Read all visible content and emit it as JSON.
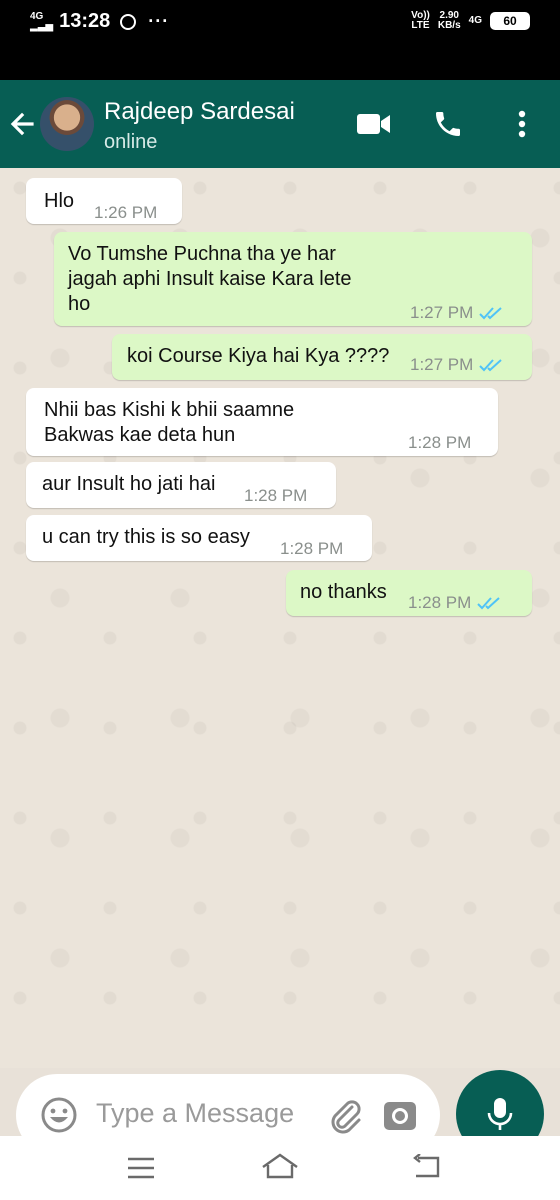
{
  "status_bar": {
    "network": "4G",
    "time": "13:28",
    "dots": "···",
    "volte_top": "Vo))",
    "volte_bottom": "LTE",
    "speed_top": "2.90",
    "speed_bottom": "KB/s",
    "network_right": "4G",
    "battery": "60"
  },
  "header": {
    "contact_name": "Rajdeep Sardesai",
    "contact_status": "online",
    "accent_color": "#075e54"
  },
  "messages": [
    {
      "direction": "in",
      "text": "Hlo",
      "time": "1:26 PM"
    },
    {
      "direction": "out",
      "text_lines": [
        "Vo Tumshe Puchna tha ye har",
        "jagah aphi Insult kaise Kara lete",
        "ho"
      ],
      "time": "1:27 PM",
      "read": true
    },
    {
      "direction": "out",
      "text": "koi Course Kiya hai Kya ????",
      "time": "1:27 PM",
      "read": true
    },
    {
      "direction": "in",
      "text_lines": [
        "Nhii bas Kishi k bhii saamne",
        "Bakwas kae deta hun"
      ],
      "time": "1:28 PM"
    },
    {
      "direction": "in",
      "text": "aur Insult ho jati hai",
      "time": "1:28 PM"
    },
    {
      "direction": "in",
      "text": "u can try this is so easy",
      "time": "1:28 PM"
    },
    {
      "direction": "out",
      "text": "no thanks",
      "time": "1:28 PM",
      "read": true
    }
  ],
  "composer": {
    "placeholder": "Type a Message"
  },
  "icons": [
    "back-arrow-icon",
    "video-call-icon",
    "voice-call-icon",
    "more-options-icon",
    "emoji-icon",
    "attach-icon",
    "camera-icon",
    "mic-icon",
    "menu-icon",
    "home-icon",
    "back-icon"
  ],
  "colors": {
    "outgoing_bubble": "#dcf8c6",
    "incoming_bubble": "#ffffff",
    "read_ticks": "#4fc3f7"
  }
}
